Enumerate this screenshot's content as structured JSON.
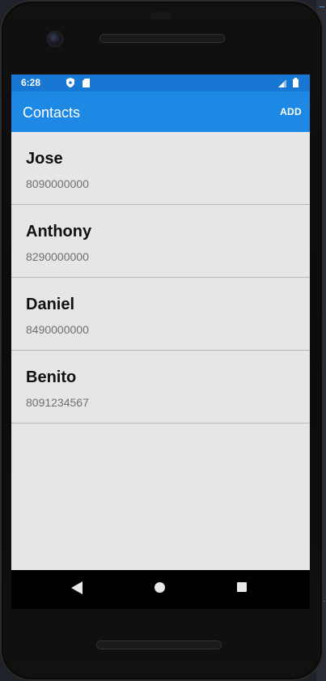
{
  "status_bar": {
    "time": "6:28",
    "icons": [
      "shield-icon",
      "sd-card-icon",
      "signal-icon",
      "battery-icon"
    ]
  },
  "app_bar": {
    "title": "Contacts",
    "add_label": "ADD"
  },
  "contacts": [
    {
      "name": "Jose",
      "phone": "8090000000"
    },
    {
      "name": "Anthony",
      "phone": "8290000000"
    },
    {
      "name": "Daniel",
      "phone": "8490000000"
    },
    {
      "name": "Benito",
      "phone": "8091234567"
    }
  ],
  "nav_bar": {
    "icons": [
      "back-icon",
      "home-icon",
      "recents-icon"
    ]
  },
  "colors": {
    "status_bar": "#1777d2",
    "app_bar": "#1e88e5",
    "list_background": "#e6e6e6",
    "divider": "#b7b7b7"
  }
}
